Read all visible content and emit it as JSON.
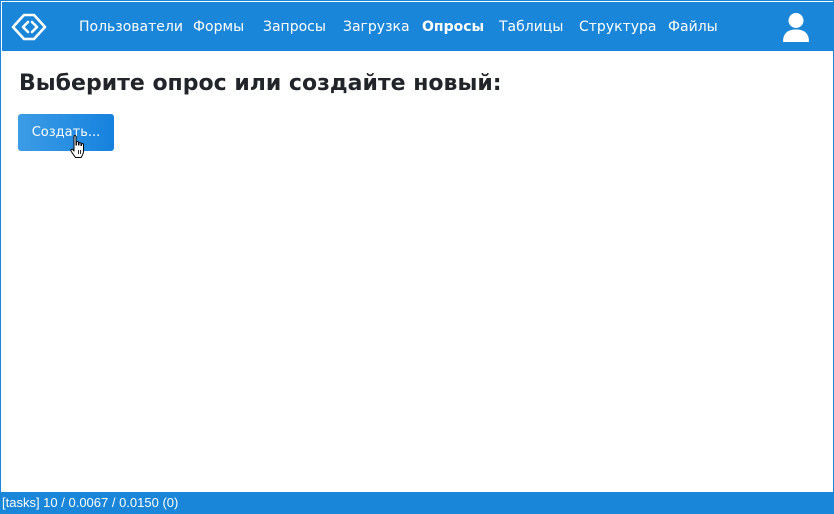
{
  "navbar": {
    "logo_icon": "diamond-chevrons-logo",
    "items": [
      {
        "label": "Пользователи",
        "active": false
      },
      {
        "label": "Формы",
        "active": false
      },
      {
        "label": "Запросы",
        "active": false
      },
      {
        "label": "Загрузка",
        "active": false
      },
      {
        "label": "Опросы",
        "active": true
      },
      {
        "label": "Таблицы",
        "active": false
      },
      {
        "label": "Структура",
        "active": false
      },
      {
        "label": "Файлы",
        "active": false
      }
    ],
    "user_icon": "user-icon"
  },
  "main": {
    "heading": "Выберите опрос или создайте новый:",
    "create_button": "Создать..."
  },
  "statusbar": {
    "text": "[tasks] 10 / 0.0067 / 0.0150 (0)"
  },
  "colors": {
    "brand": "#1a86d9",
    "button_start": "#3c9ce6",
    "button_end": "#1682de",
    "text": "#212529"
  }
}
